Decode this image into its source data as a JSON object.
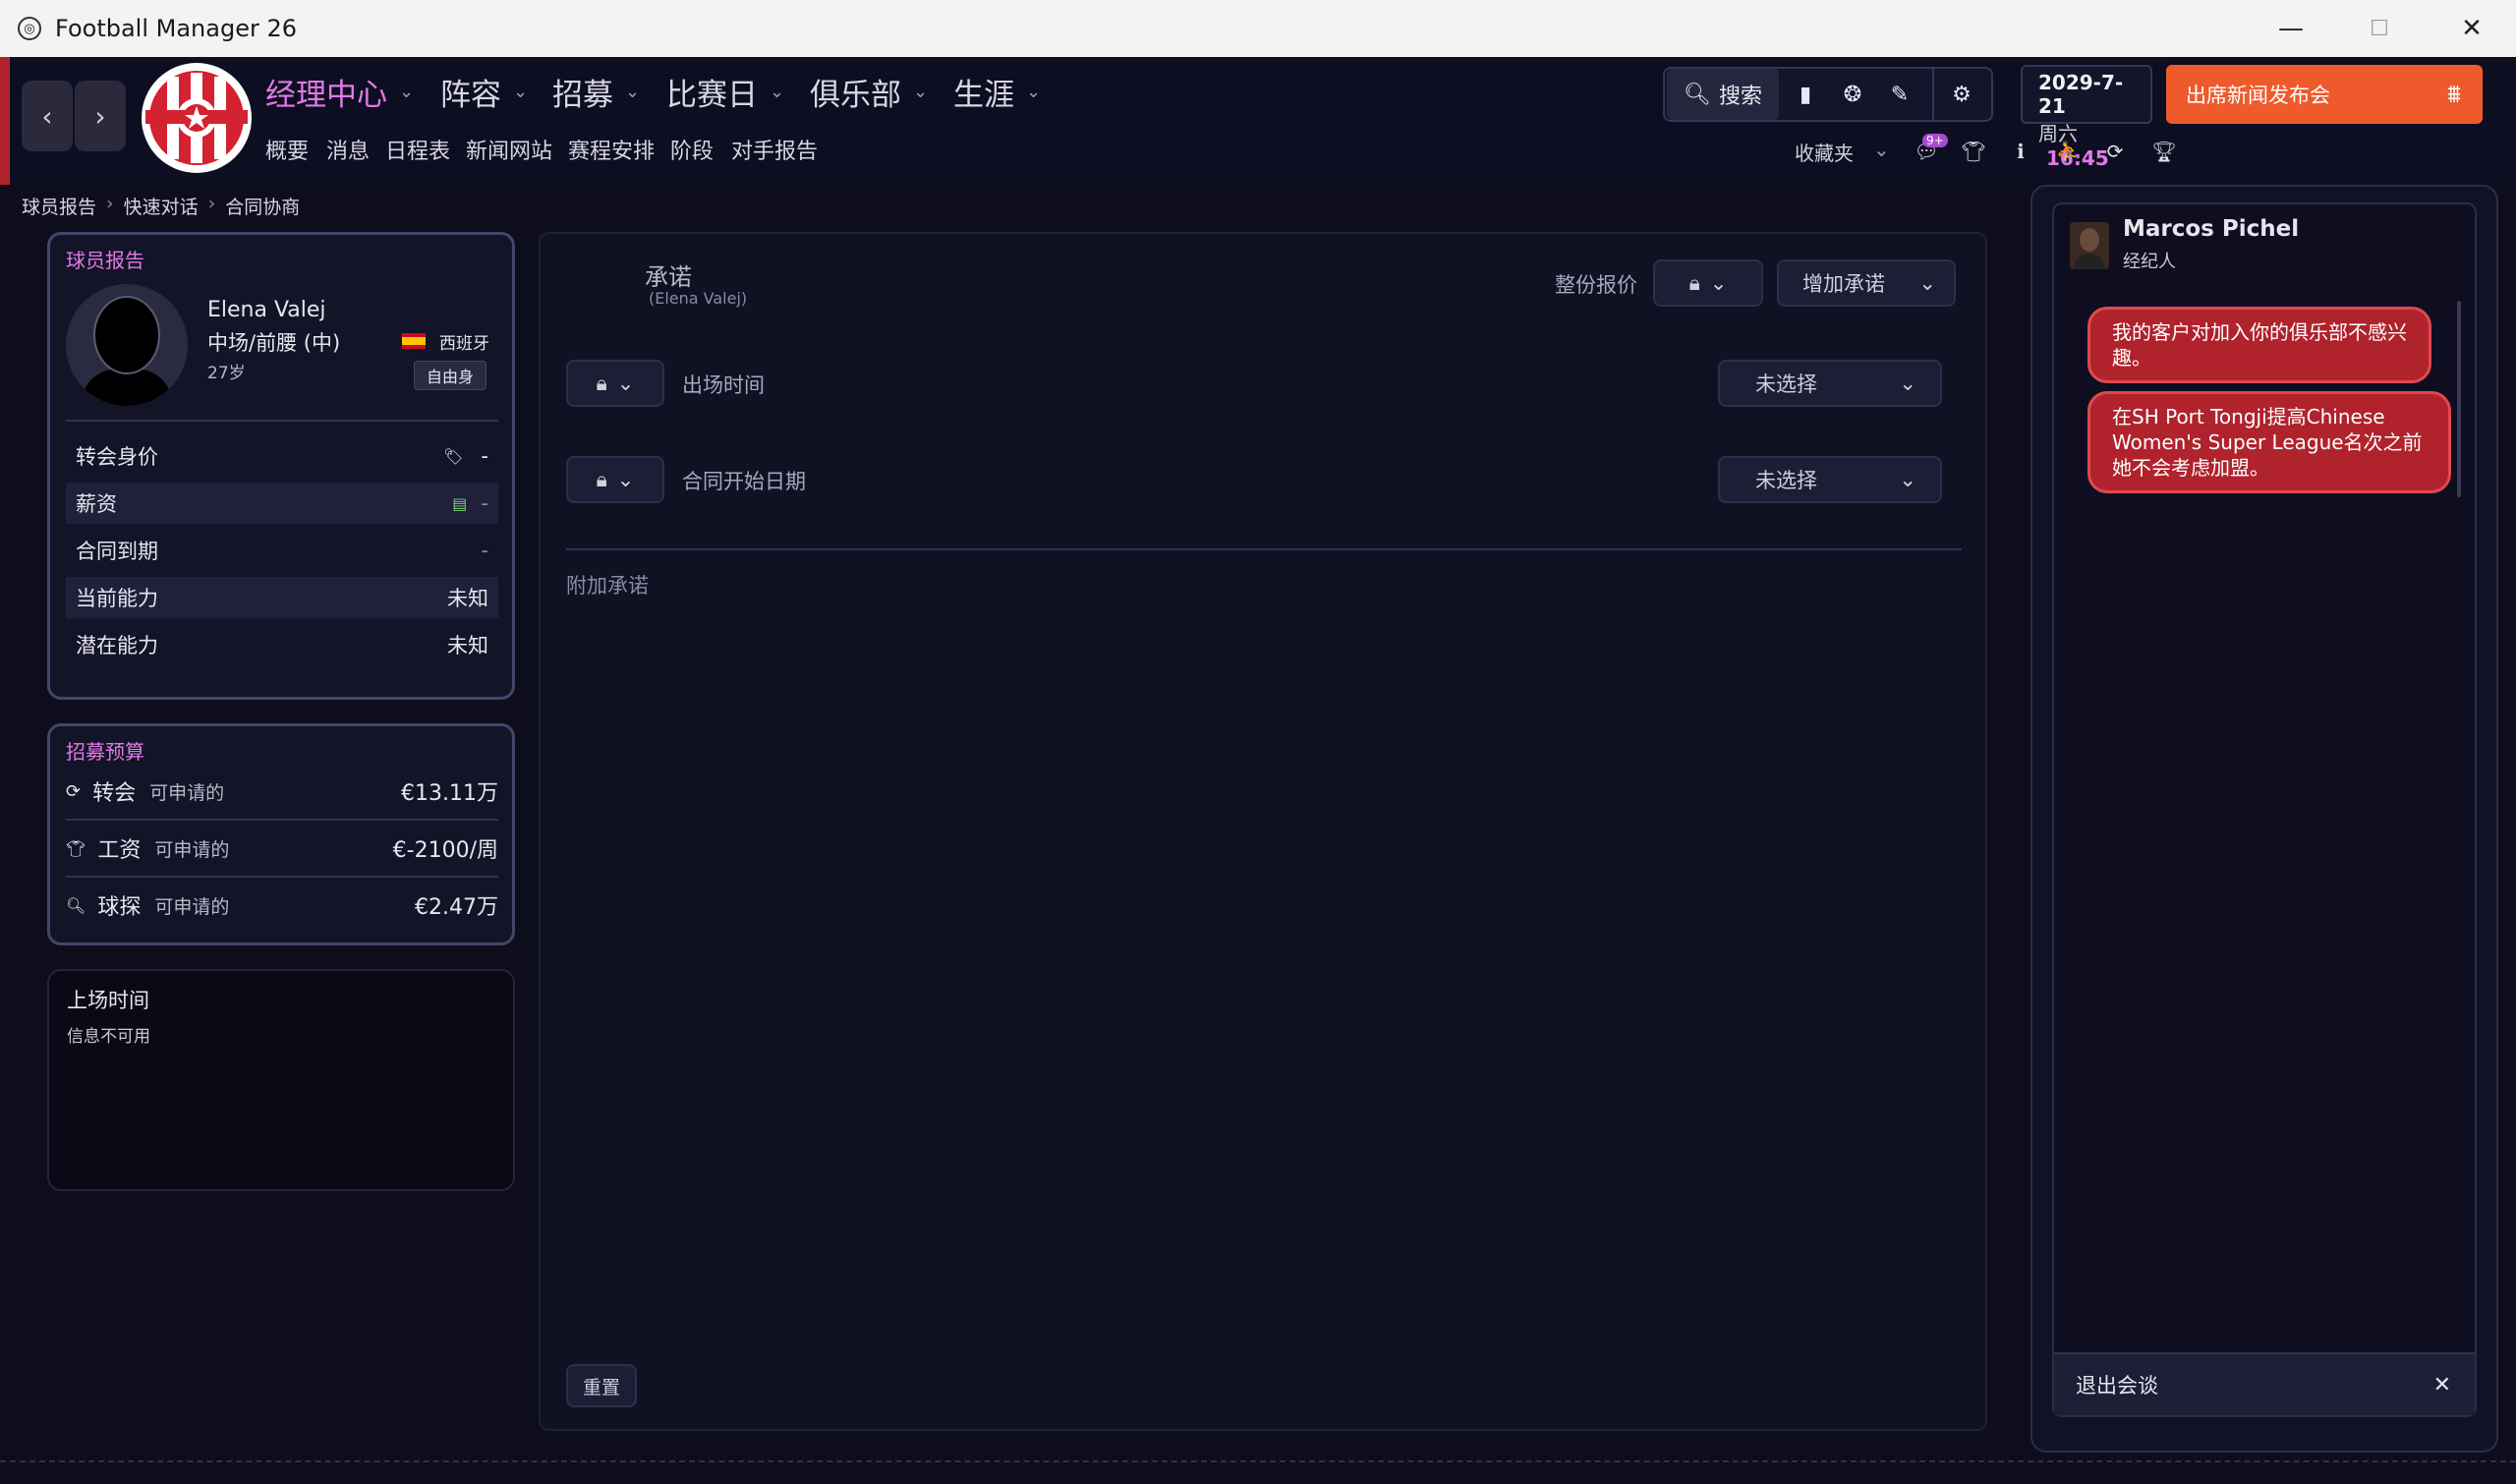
{
  "window": {
    "title": "Football Manager 26",
    "min": "—",
    "max": "☐",
    "close": "✕"
  },
  "nav": {
    "back": "‹",
    "forward": "›"
  },
  "menu": [
    {
      "label": "经理中心",
      "active": true
    },
    {
      "label": "阵容"
    },
    {
      "label": "招募"
    },
    {
      "label": "比赛日"
    },
    {
      "label": "俱乐部"
    },
    {
      "label": "生涯"
    }
  ],
  "submenu": [
    "概要",
    "消息",
    "日程表",
    "新闻网站",
    "赛程安排",
    "阶段",
    "对手报告"
  ],
  "toolbar": {
    "search_label": "搜索",
    "favorites_label": "收藏夹",
    "badge": "9+"
  },
  "date": {
    "date": "2029-7-21",
    "weekday": "周六",
    "time": "16:45"
  },
  "press_button": "出席新闻发布会",
  "breadcrumb": [
    "球员报告",
    "快速对话",
    "合同协商"
  ],
  "player_report": {
    "title": "球员报告",
    "name": "Elena Valej",
    "position": "中场/前腰 (中)",
    "age": "27岁",
    "nation": "西班牙",
    "status": "自由身",
    "rows": [
      {
        "label": "转会身价",
        "value": "-"
      },
      {
        "label": "薪资",
        "value": "-"
      },
      {
        "label": "合同到期",
        "value": "-"
      },
      {
        "label": "当前能力",
        "value": "未知"
      },
      {
        "label": "潜在能力",
        "value": "未知"
      }
    ]
  },
  "budget": {
    "title": "招募预算",
    "rows": [
      {
        "label": "转会",
        "sub": "可申请的",
        "value": "€13.11万"
      },
      {
        "label": "工资",
        "sub": "可申请的",
        "value": "€-2100/周"
      },
      {
        "label": "球探",
        "sub": "可申请的",
        "value": "€2.47万"
      }
    ]
  },
  "playtime": {
    "title": "上场时间",
    "text": "信息不可用"
  },
  "promises": {
    "title": "承诺",
    "subtitle": "(Elena Valej)",
    "package_label": "整份报价",
    "add_label": "增加承诺",
    "items": [
      {
        "label": "出场时间",
        "value": "未选择"
      },
      {
        "label": "合同开始日期",
        "value": "未选择"
      }
    ],
    "extra_label": "附加承诺",
    "reset_label": "重置"
  },
  "chat": {
    "agent_name": "Marcos Pichel",
    "agent_role": "经纪人",
    "messages": [
      "我的客户对加入你的俱乐部不感兴趣。",
      "在SH Port Tongji提高Chinese Women's Super League名次之前她不会考虑加盟。"
    ],
    "exit_label": "退出会谈"
  },
  "colors": {
    "accent": "#e07ae6",
    "press": "#ef5a2c",
    "bubble": "#b0232c"
  }
}
